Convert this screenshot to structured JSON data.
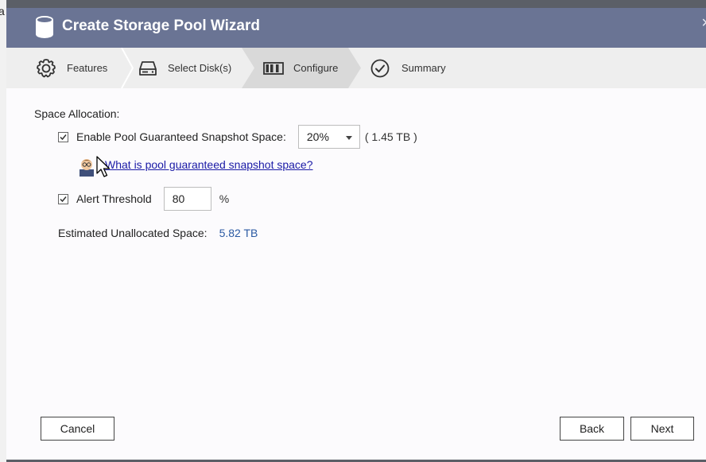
{
  "window": {
    "title": "Create Storage Pool Wizard",
    "close_glyph": "×"
  },
  "background": {
    "partial_text": "a"
  },
  "steps": [
    {
      "label": "Features",
      "icon": "gear-icon"
    },
    {
      "label": "Select Disk(s)",
      "icon": "disk-icon"
    },
    {
      "label": "Configure",
      "icon": "configure-icon",
      "active": true
    },
    {
      "label": "Summary",
      "icon": "check-circle-icon"
    }
  ],
  "space_allocation": {
    "heading": "Space Allocation:",
    "snapshot": {
      "checked": true,
      "label": "Enable Pool Guaranteed Snapshot Space:",
      "selected_value": "20%",
      "size_note": "( 1.45 TB )"
    },
    "help_link": "What is pool guaranteed snapshot space?",
    "alert": {
      "checked": true,
      "label": "Alert Threshold",
      "value": "80",
      "unit": "%"
    },
    "estimated": {
      "label": "Estimated Unallocated Space:",
      "value": "5.82 TB"
    }
  },
  "buttons": {
    "cancel": "Cancel",
    "back": "Back",
    "next": "Next"
  },
  "colors": {
    "titlebar": "#6a7494",
    "link": "#1a1aa6",
    "value_blue": "#2b5aa3"
  }
}
